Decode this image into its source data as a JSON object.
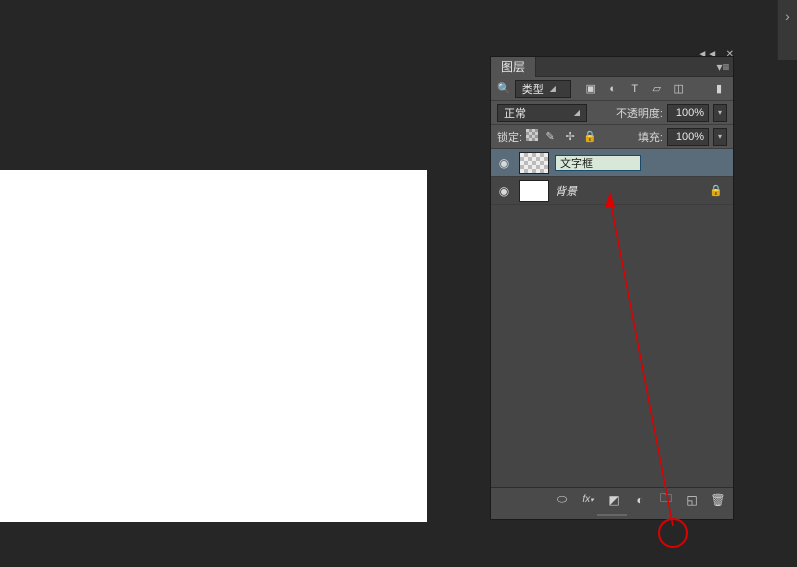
{
  "panel": {
    "tab_label": "图层",
    "filter": {
      "type_label": "类型",
      "icons": [
        "image-filter",
        "adjust-filter",
        "type-filter",
        "shape-filter",
        "smart-filter"
      ]
    },
    "blend": {
      "mode": "正常",
      "opacity_label": "不透明度:",
      "opacity_value": "100%"
    },
    "lock": {
      "label": "锁定:",
      "fill_label": "填充:",
      "fill_value": "100%"
    },
    "layers": [
      {
        "name": "文字框",
        "editing": true,
        "thumb": "checker",
        "locked": false
      },
      {
        "name": "背景",
        "editing": false,
        "thumb": "white",
        "locked": true
      }
    ],
    "bottom_icons": [
      "link",
      "fx",
      "mask",
      "adjustment",
      "group",
      "new-layer",
      "trash"
    ]
  }
}
